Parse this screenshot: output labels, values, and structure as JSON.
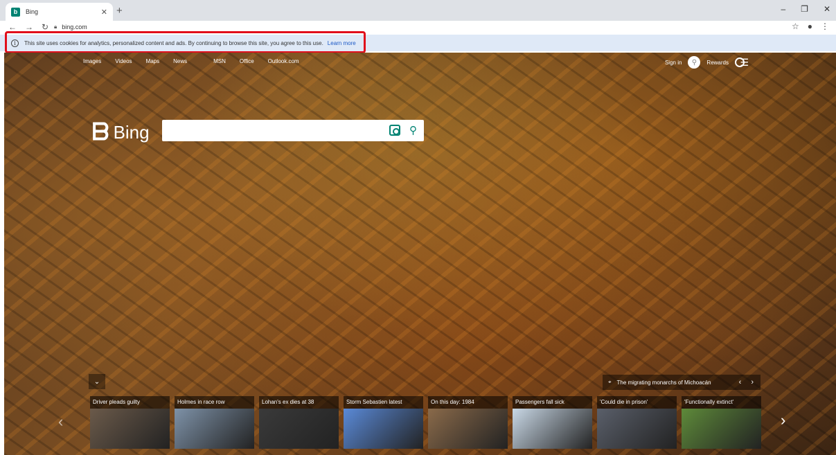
{
  "browser": {
    "tab_title": "Bing",
    "favicon_letter": "b",
    "url": "bing.com",
    "window_controls": [
      "–",
      "❐",
      "✕"
    ]
  },
  "cookie_banner": {
    "text": "This site uses cookies for analytics, personalized content and ads. By continuing to browse this site, you agree to this use.",
    "link": "Learn more"
  },
  "bing": {
    "nav": [
      "Images",
      "Videos",
      "Maps",
      "News",
      "MSN",
      "Office",
      "Outlook.com"
    ],
    "sign_in": "Sign in",
    "rewards": "Rewards",
    "logo_text": "Bing",
    "search_value": "",
    "location": "The migrating monarchs of Michoacán"
  },
  "news": [
    {
      "title": "Driver pleads guilty",
      "color": "#6b5a4a"
    },
    {
      "title": "Holmes in race row",
      "color": "#7e92a8"
    },
    {
      "title": "Lohan's ex dies at 38",
      "color": "#3a3a3a"
    },
    {
      "title": "Storm Sebastien latest",
      "color": "#5a8ad8"
    },
    {
      "title": "On this day: 1984",
      "color": "#8a6a4a"
    },
    {
      "title": "Passengers fall sick",
      "color": "#c9d8e6"
    },
    {
      "title": "'Could die in prison'",
      "color": "#5a5f6a"
    },
    {
      "title": "'Functionally extinct'",
      "color": "#5e8a3a"
    }
  ]
}
